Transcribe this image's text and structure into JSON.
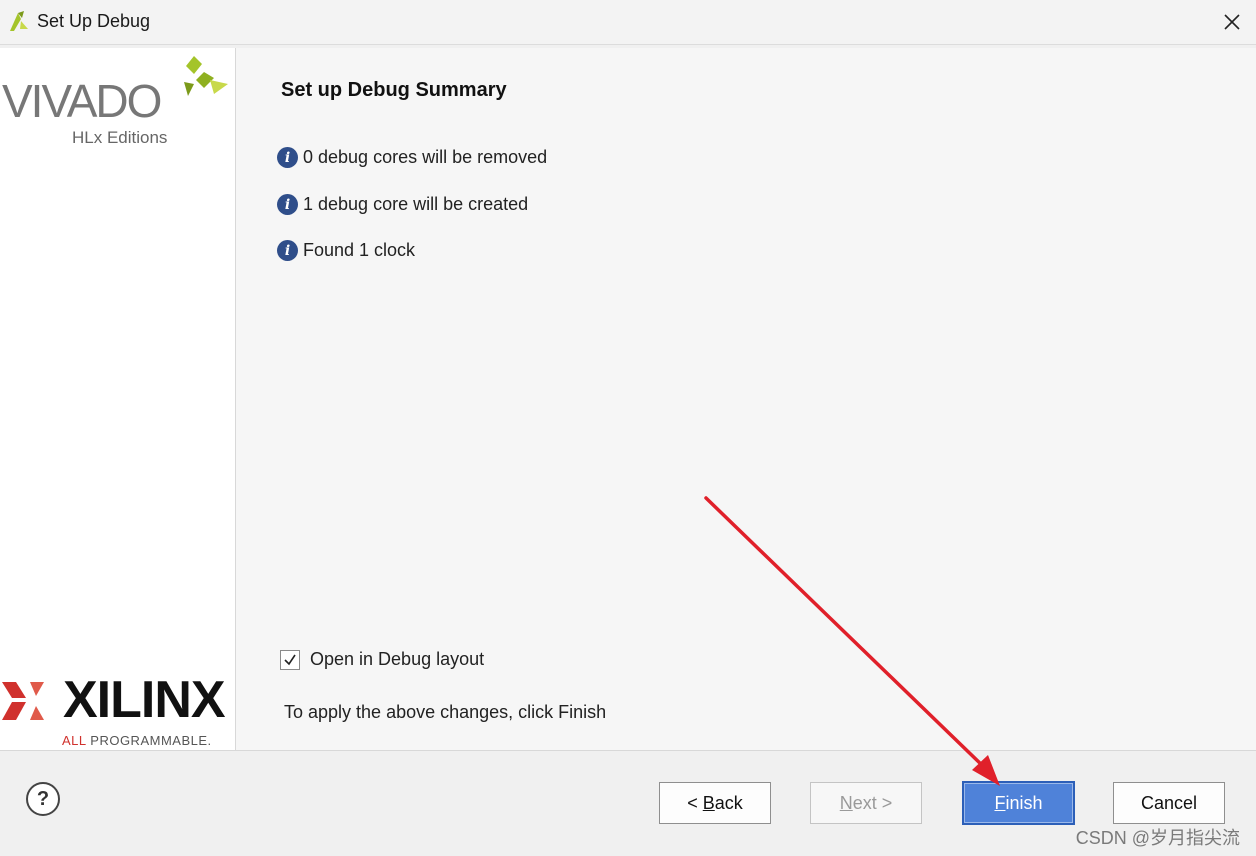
{
  "window": {
    "title": "Set Up Debug"
  },
  "sidebar": {
    "vivado_word": "VIVADO",
    "hlx_text": "HLx Editions",
    "xilinx_word": "XILINX",
    "xilinx_tag_all": "ALL",
    "xilinx_tag_rest": " PROGRAMMABLE."
  },
  "main": {
    "title": "Set up Debug Summary",
    "info_items": [
      "0 debug cores will be removed",
      "1 debug core will be created",
      "Found 1 clock"
    ],
    "checkbox": {
      "label": "Open in Debug layout",
      "checked": true
    },
    "apply_text": "To apply the above changes, click Finish"
  },
  "footer": {
    "help": "?",
    "back_pre": "< ",
    "back_mn": "B",
    "back_rest": "ack",
    "next_mn": "N",
    "next_rest": "ext >",
    "finish_mn": "F",
    "finish_rest": "inish",
    "cancel": "Cancel"
  },
  "watermark": "CSDN @岁月指尖流",
  "colors": {
    "accent": "#4f82d9",
    "info_icon": "#2f4e8a",
    "arrow": "#e0202a",
    "vivado_green": "#a4c42a",
    "xilinx_red": "#d0312d"
  }
}
